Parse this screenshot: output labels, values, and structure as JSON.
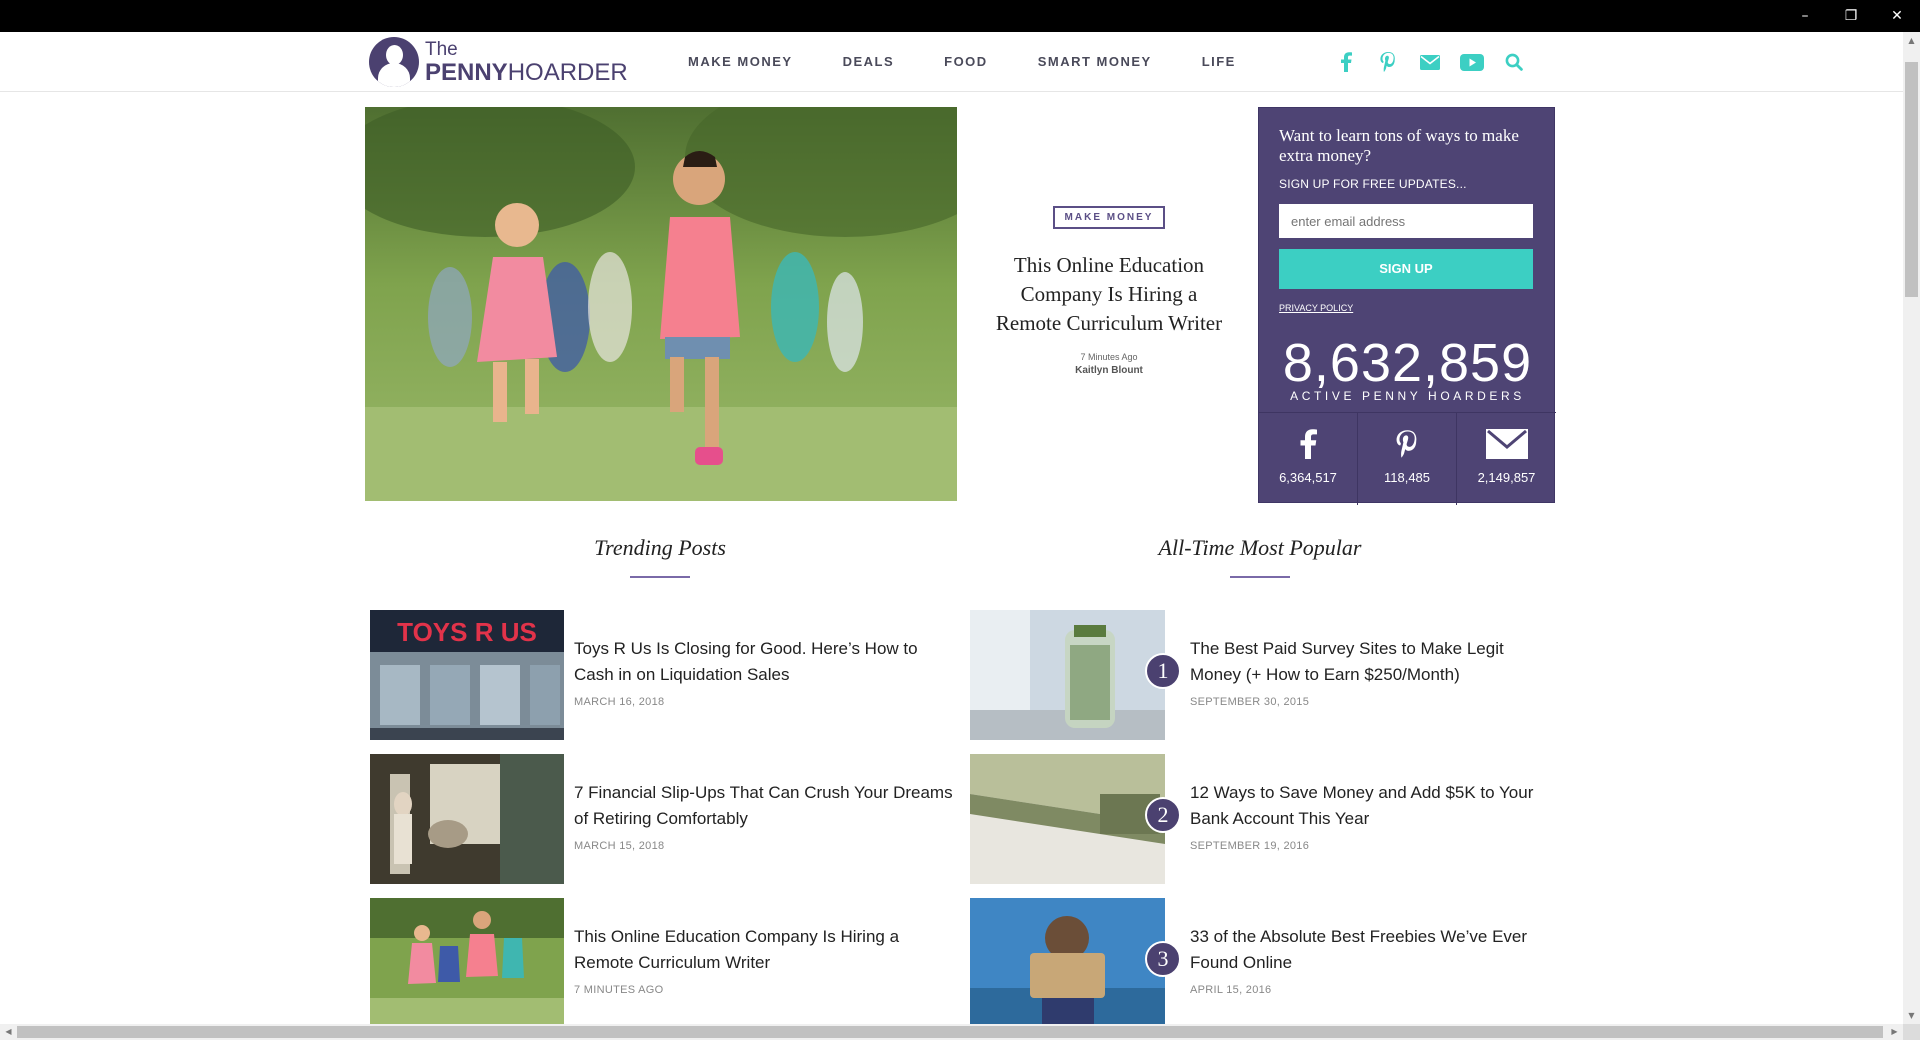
{
  "window": {
    "minimize": "–",
    "maximize": "❐",
    "close": "✕"
  },
  "logo": {
    "line1": "The",
    "line2_bold": "PENNY",
    "line2_light": "HOARDER"
  },
  "nav": [
    "MAKE MONEY",
    "DEALS",
    "FOOD",
    "SMART MONEY",
    "LIFE"
  ],
  "colors": {
    "accent": "#3ccfc3",
    "brand": "#4b4170"
  },
  "social_icons": [
    "facebook-icon",
    "pinterest-icon",
    "email-icon",
    "youtube-icon",
    "search-icon"
  ],
  "hero": {
    "tag": "MAKE MONEY",
    "title": "This Online Education Company Is Hiring a Remote Curriculum Writer",
    "time": "7 Minutes Ago",
    "author": "Kaitlyn Blount"
  },
  "signup": {
    "heading": "Want to learn tons of ways to make extra money?",
    "subheading": "SIGN UP FOR FREE UPDATES...",
    "email_placeholder": "enter email address",
    "button": "SIGN UP",
    "privacy": "PRIVACY POLICY",
    "count": "8,632,859",
    "count_label": "ACTIVE PENNY HOARDERS",
    "stats": [
      {
        "icon": "facebook-icon",
        "value": "6,364,517"
      },
      {
        "icon": "pinterest-icon",
        "value": "118,485"
      },
      {
        "icon": "email-icon",
        "value": "2,149,857"
      }
    ]
  },
  "trending": {
    "title": "Trending Posts",
    "posts": [
      {
        "title": "Toys R Us Is Closing for Good. Here’s How to Cash in on Liquidation Sales",
        "date": "MARCH 16, 2018",
        "thumb_text": "TOYS R US"
      },
      {
        "title": "7 Financial Slip-Ups That Can Crush Your Dreams of Retiring Comfortably",
        "date": "MARCH 15, 2018"
      },
      {
        "title": "This Online Education Company Is Hiring a Remote Curriculum Writer",
        "date": "7 MINUTES AGO"
      }
    ]
  },
  "popular": {
    "title": "All-Time Most Popular",
    "posts": [
      {
        "rank": "1",
        "title": "The Best Paid Survey Sites to Make Legit Money (+ How to Earn $250/Month)",
        "date": "SEPTEMBER 30, 2015"
      },
      {
        "rank": "2",
        "title": "12 Ways to Save Money and Add $5K to Your Bank Account This Year",
        "date": "SEPTEMBER 19, 2016"
      },
      {
        "rank": "3",
        "title": "33 of the Absolute Best Freebies We’ve Ever Found Online",
        "date": "APRIL 15, 2016"
      }
    ]
  }
}
